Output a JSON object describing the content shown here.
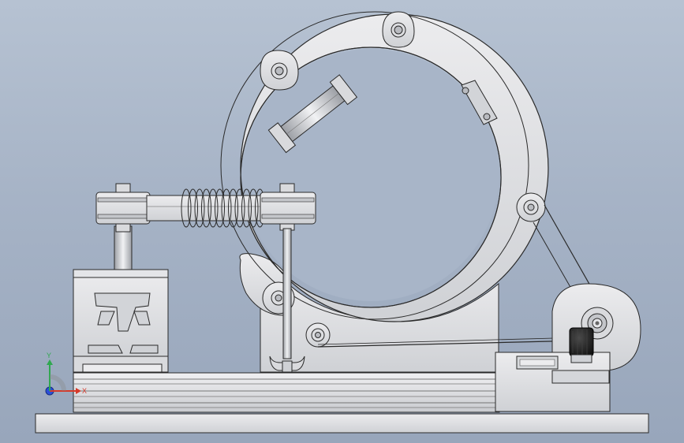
{
  "viewport": {
    "scene": "mechanical-assembly-view"
  },
  "triad": {
    "x_label": "X",
    "y_label": "Y",
    "colors": {
      "x_axis": "#d63a2a",
      "y_axis": "#2fa84f",
      "z_axis": "#2b4fd8"
    }
  },
  "colors": {
    "background_top": "#b6c2d2",
    "background_bottom": "#98a6bb",
    "part_fill": "#d9dadd",
    "part_fill_light": "#ececee",
    "edge": "#2a2a2a",
    "knob": "#1b1b1b"
  }
}
